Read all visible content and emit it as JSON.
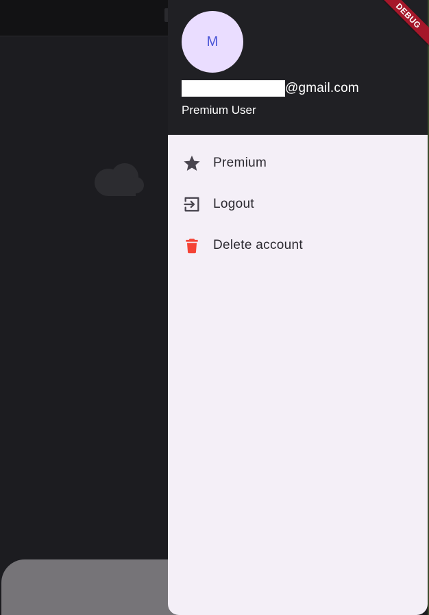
{
  "drawer": {
    "avatar_initial": "M",
    "email_domain": "@gmail.com",
    "user_tier": "Premium User"
  },
  "menu": {
    "items": [
      {
        "label": "Premium",
        "icon": "star-icon"
      },
      {
        "label": "Logout",
        "icon": "logout-icon"
      },
      {
        "label": "Delete account",
        "icon": "trash-icon"
      }
    ]
  },
  "debug_banner": "DEBUG",
  "colors": {
    "drawer_background": "#f4eff7",
    "header_background": "#202024",
    "avatar_background": "#eaddff",
    "avatar_text": "#4a55d6",
    "delete_icon": "#f44336",
    "debug_ribbon": "#a5172a"
  }
}
